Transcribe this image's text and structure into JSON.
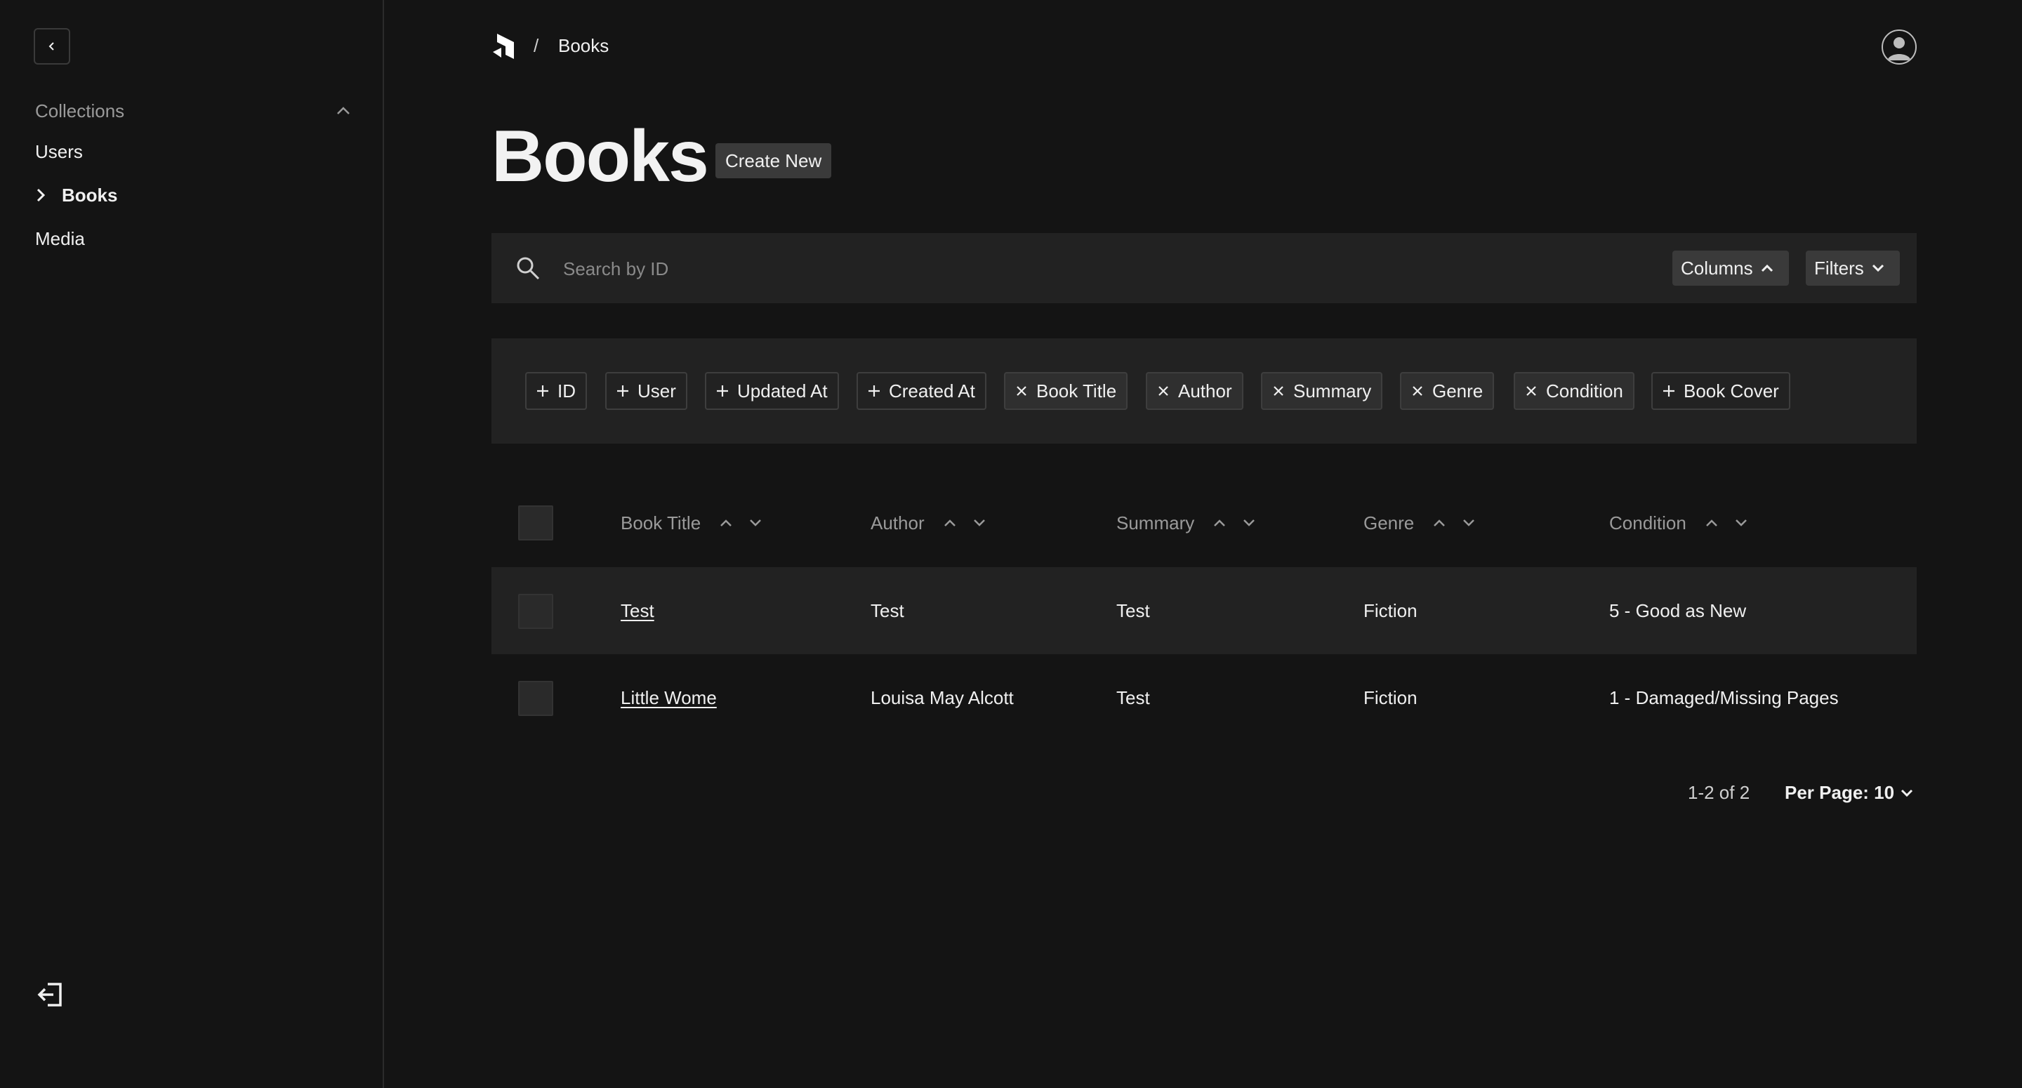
{
  "sidebar": {
    "group_label": "Collections",
    "items": [
      {
        "label": "Users"
      },
      {
        "label": "Books"
      },
      {
        "label": "Media"
      }
    ]
  },
  "breadcrumb": {
    "separator": "/",
    "current": "Books"
  },
  "page": {
    "title": "Books",
    "create_label": "Create New"
  },
  "search": {
    "placeholder": "Search by ID",
    "columns_label": "Columns",
    "filters_label": "Filters"
  },
  "column_toggles": [
    {
      "label": "ID",
      "enabled": false
    },
    {
      "label": "User",
      "enabled": false
    },
    {
      "label": "Updated At",
      "enabled": false
    },
    {
      "label": "Created At",
      "enabled": false
    },
    {
      "label": "Book Title",
      "enabled": true
    },
    {
      "label": "Author",
      "enabled": true
    },
    {
      "label": "Summary",
      "enabled": true
    },
    {
      "label": "Genre",
      "enabled": true
    },
    {
      "label": "Condition",
      "enabled": true
    },
    {
      "label": "Book Cover",
      "enabled": false
    }
  ],
  "table": {
    "headers": [
      "Book Title",
      "Author",
      "Summary",
      "Genre",
      "Condition"
    ],
    "rows": [
      {
        "title": "Test",
        "author": "Test",
        "summary": "Test",
        "genre": "Fiction",
        "condition": "5 - Good as New"
      },
      {
        "title": "Little Wome",
        "author": "Louisa May Alcott",
        "summary": "Test",
        "genre": "Fiction",
        "condition": "1 - Damaged/Missing Pages"
      }
    ]
  },
  "pagination": {
    "range": "1-2 of 2",
    "per_page": "Per Page: 10"
  },
  "colors": {
    "background": "#141414",
    "panel": "#222222",
    "chip_border": "#3e3e3e",
    "button": "#3a3a3a",
    "text": "#f2f2f2",
    "muted": "#9a9a9a"
  }
}
